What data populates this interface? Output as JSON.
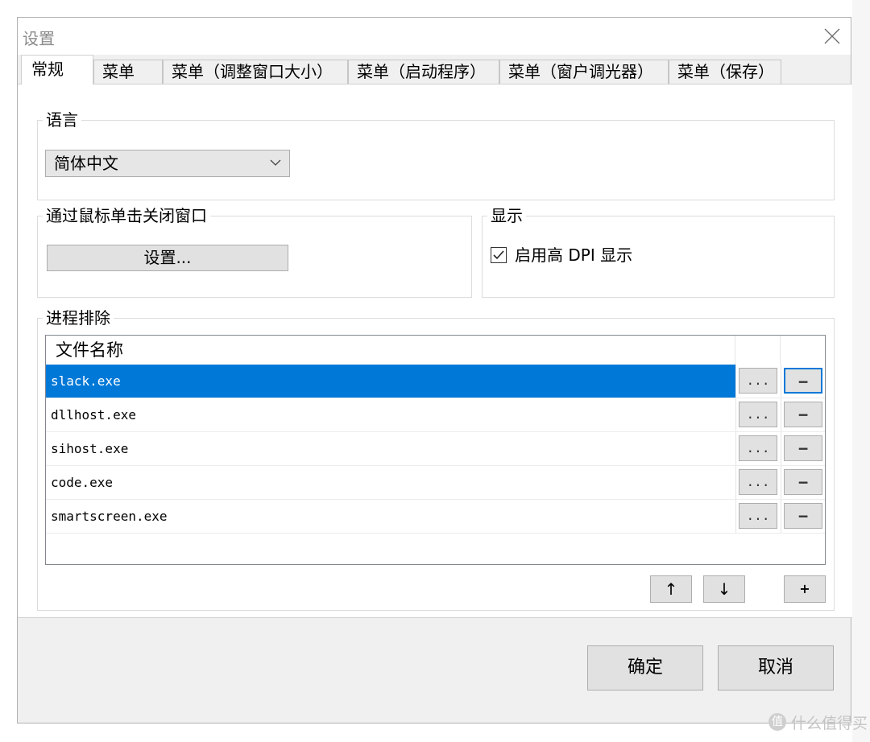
{
  "window": {
    "title": "设置"
  },
  "tabs": [
    {
      "label": "常规",
      "active": true
    },
    {
      "label": "菜单",
      "active": false
    },
    {
      "label": "菜单（调整窗口大小）",
      "active": false
    },
    {
      "label": "菜单（启动程序）",
      "active": false
    },
    {
      "label": "菜单（窗户调光器）",
      "active": false
    },
    {
      "label": "菜单（保存）",
      "active": false
    }
  ],
  "language": {
    "group_label": "语言",
    "selected": "简体中文"
  },
  "mouse_close": {
    "group_label": "通过鼠标单击关闭窗口",
    "button_label": "设置..."
  },
  "display": {
    "group_label": "显示",
    "high_dpi_label": "启用高 DPI 显示",
    "high_dpi_checked": true
  },
  "process_exclusion": {
    "group_label": "进程排除",
    "column_header": "文件名称",
    "rows": [
      {
        "name": "slack.exe",
        "selected": true,
        "browse_label": "...",
        "remove_label": "−"
      },
      {
        "name": "dllhost.exe",
        "selected": false,
        "browse_label": "...",
        "remove_label": "−"
      },
      {
        "name": "sihost.exe",
        "selected": false,
        "browse_label": "...",
        "remove_label": "−"
      },
      {
        "name": "code.exe",
        "selected": false,
        "browse_label": "...",
        "remove_label": "−"
      },
      {
        "name": "smartscreen.exe",
        "selected": false,
        "browse_label": "...",
        "remove_label": "−"
      }
    ],
    "move_up_label": "↑",
    "move_down_label": "↓",
    "add_label": "+"
  },
  "footer": {
    "ok_label": "确定",
    "cancel_label": "取消"
  },
  "watermark": {
    "text": "什么值得买"
  },
  "colors": {
    "selection": "#0078d7",
    "dialog_bg": "#f0f0f0",
    "button_bg": "#e1e1e1"
  }
}
